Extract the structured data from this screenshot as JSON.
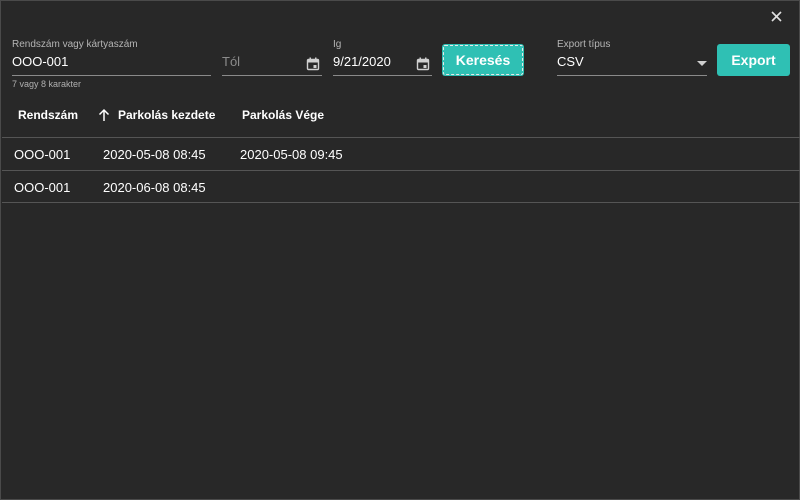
{
  "colors": {
    "accent": "#2fc0b4",
    "background": "#282828",
    "divider": "#555555"
  },
  "dialog": {
    "close_icon": "close-icon"
  },
  "filters": {
    "plate": {
      "label": "Rendszám vagy kártyaszám",
      "value": "OOO-001",
      "hint": "7 vagy 8 karakter"
    },
    "from": {
      "placeholder": "Tól",
      "icon": "calendar-icon"
    },
    "to": {
      "label": "Ig",
      "value": "9/21/2020",
      "icon": "calendar-icon"
    },
    "search_button": "Keresés",
    "export_type": {
      "label": "Export típus",
      "value": "CSV",
      "icon": "dropdown-arrow-icon"
    },
    "export_button": "Export"
  },
  "table": {
    "headers": [
      "Rendszám",
      "Parkolás kezdete",
      "Parkolás Vége"
    ],
    "sort_icon": "arrow-up-icon",
    "rows": [
      [
        "OOO-001",
        "2020-05-08 08:45",
        "2020-05-08 09:45"
      ],
      [
        "OOO-001",
        "2020-06-08 08:45",
        ""
      ]
    ]
  }
}
